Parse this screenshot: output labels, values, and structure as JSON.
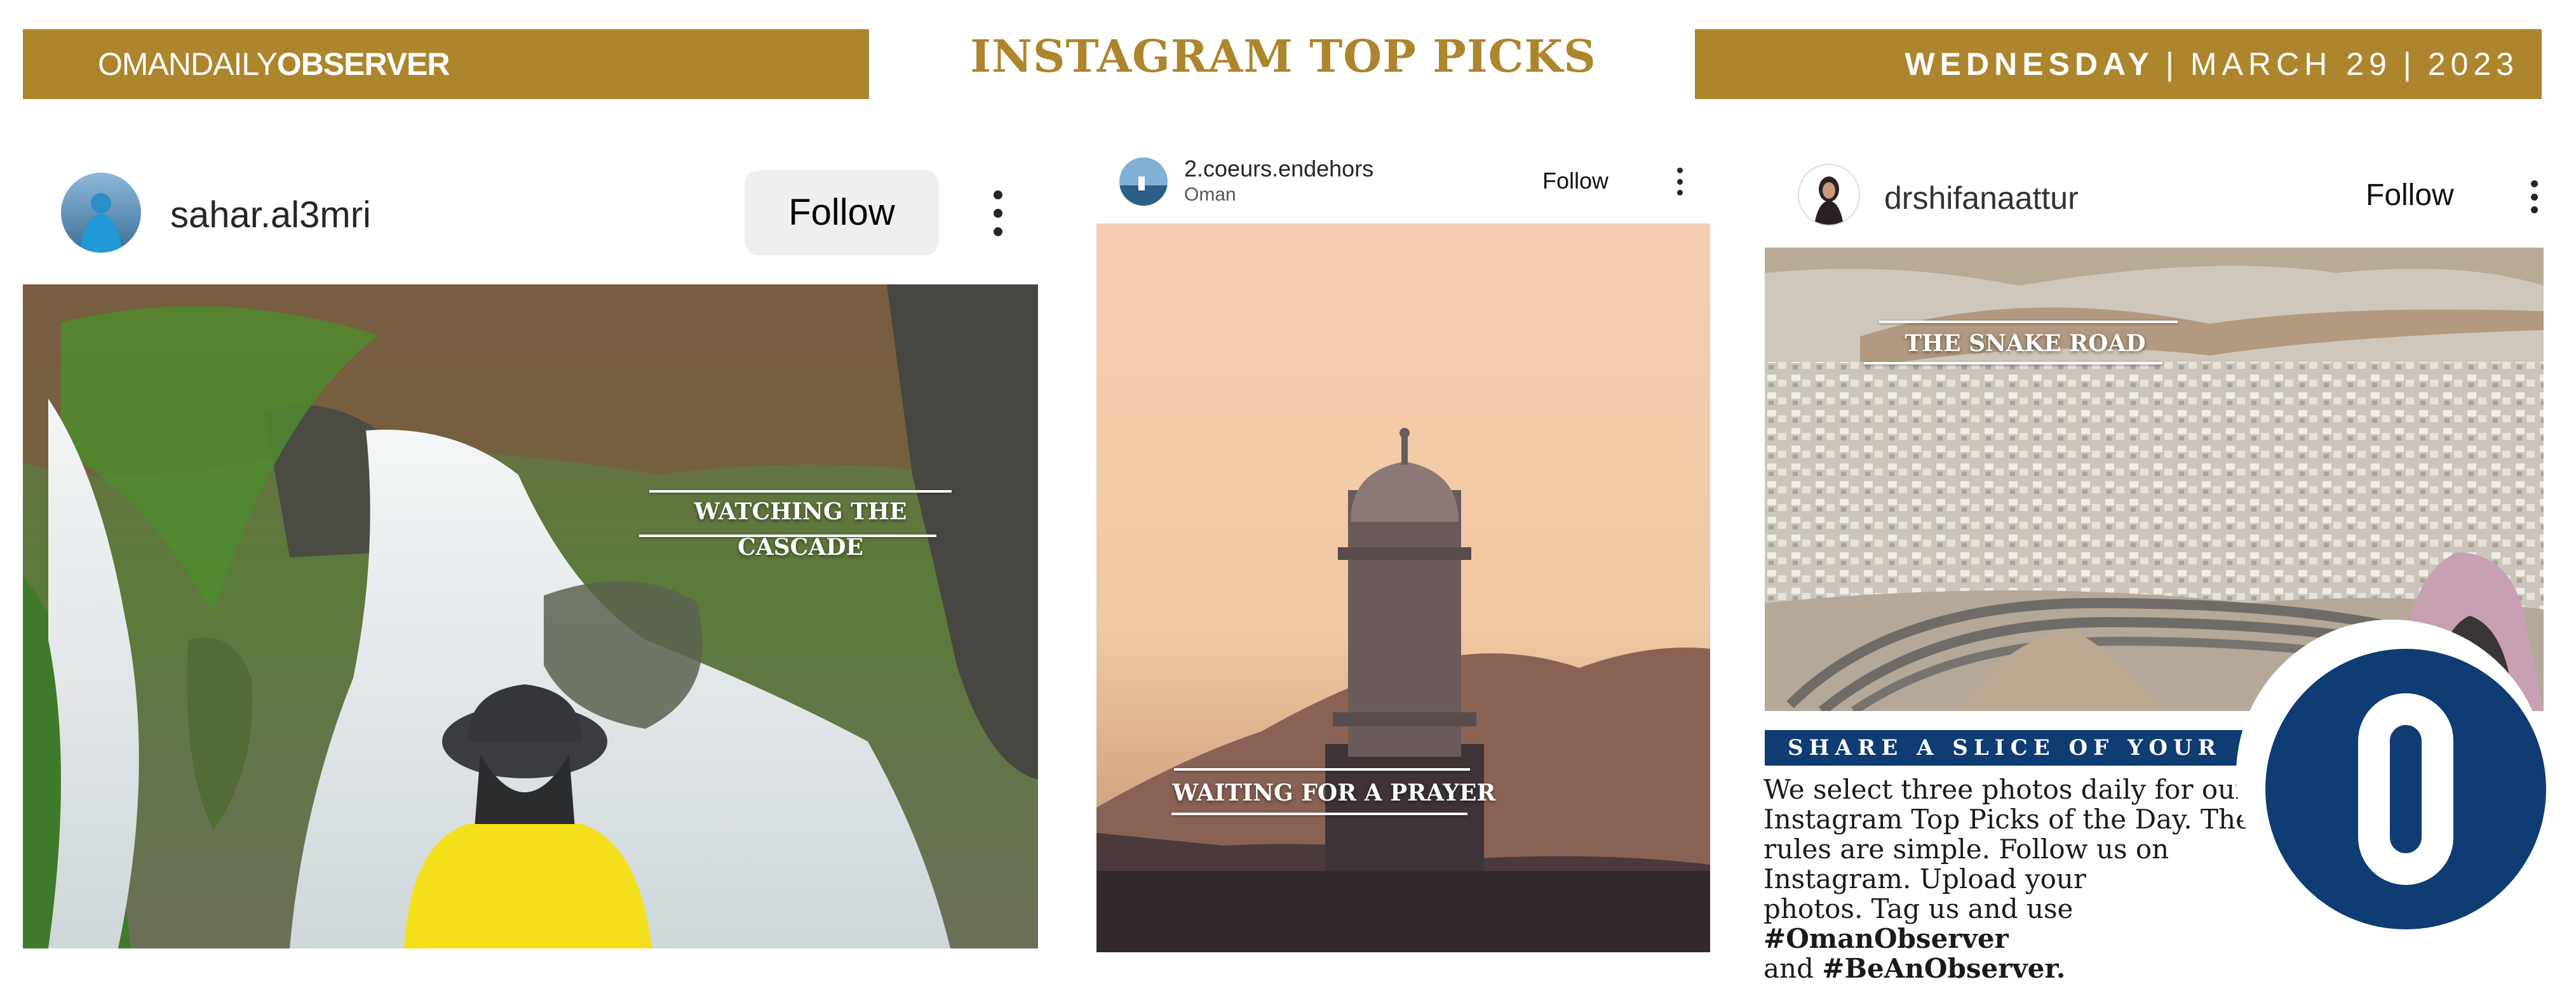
{
  "masthead": {
    "brand_light": "OMANDAILY",
    "brand_bold": "OBSERVER",
    "headline": "INSTAGRAM TOP PICKS",
    "day": "WEDNESDAY",
    "separator": "|",
    "date": "MARCH 29",
    "year": "2023"
  },
  "posts": [
    {
      "username": "sahar.al3mri",
      "location": "",
      "follow_label": "Follow",
      "caption": "WATCHING THE CASCADE"
    },
    {
      "username": "2.coeurs.endehors",
      "location": "Oman",
      "follow_label": "Follow",
      "caption": "WAITING FOR A PRAYER"
    },
    {
      "username": "drshifanaattur",
      "location": "",
      "follow_label": "Follow",
      "caption": "THE SNAKE ROAD"
    }
  ],
  "promo": {
    "heading": "SHARE A SLICE OF YOUR LIFE",
    "body_lines": [
      "We select three photos daily for our",
      "Instagram Top Picks of the Day. The",
      "rules are simple. Follow us on",
      "Instagram. Upload your"
    ],
    "line5_pre": "photos. Tag us and use ",
    "hashtag1": "#OmanObserver",
    "line6_pre": "and ",
    "hashtag2": "#BeAnObserver.",
    "logo_letter": "O"
  },
  "colors": {
    "gold": "#ad852c",
    "navy": "#0e3c73",
    "white": "#ffffff"
  }
}
